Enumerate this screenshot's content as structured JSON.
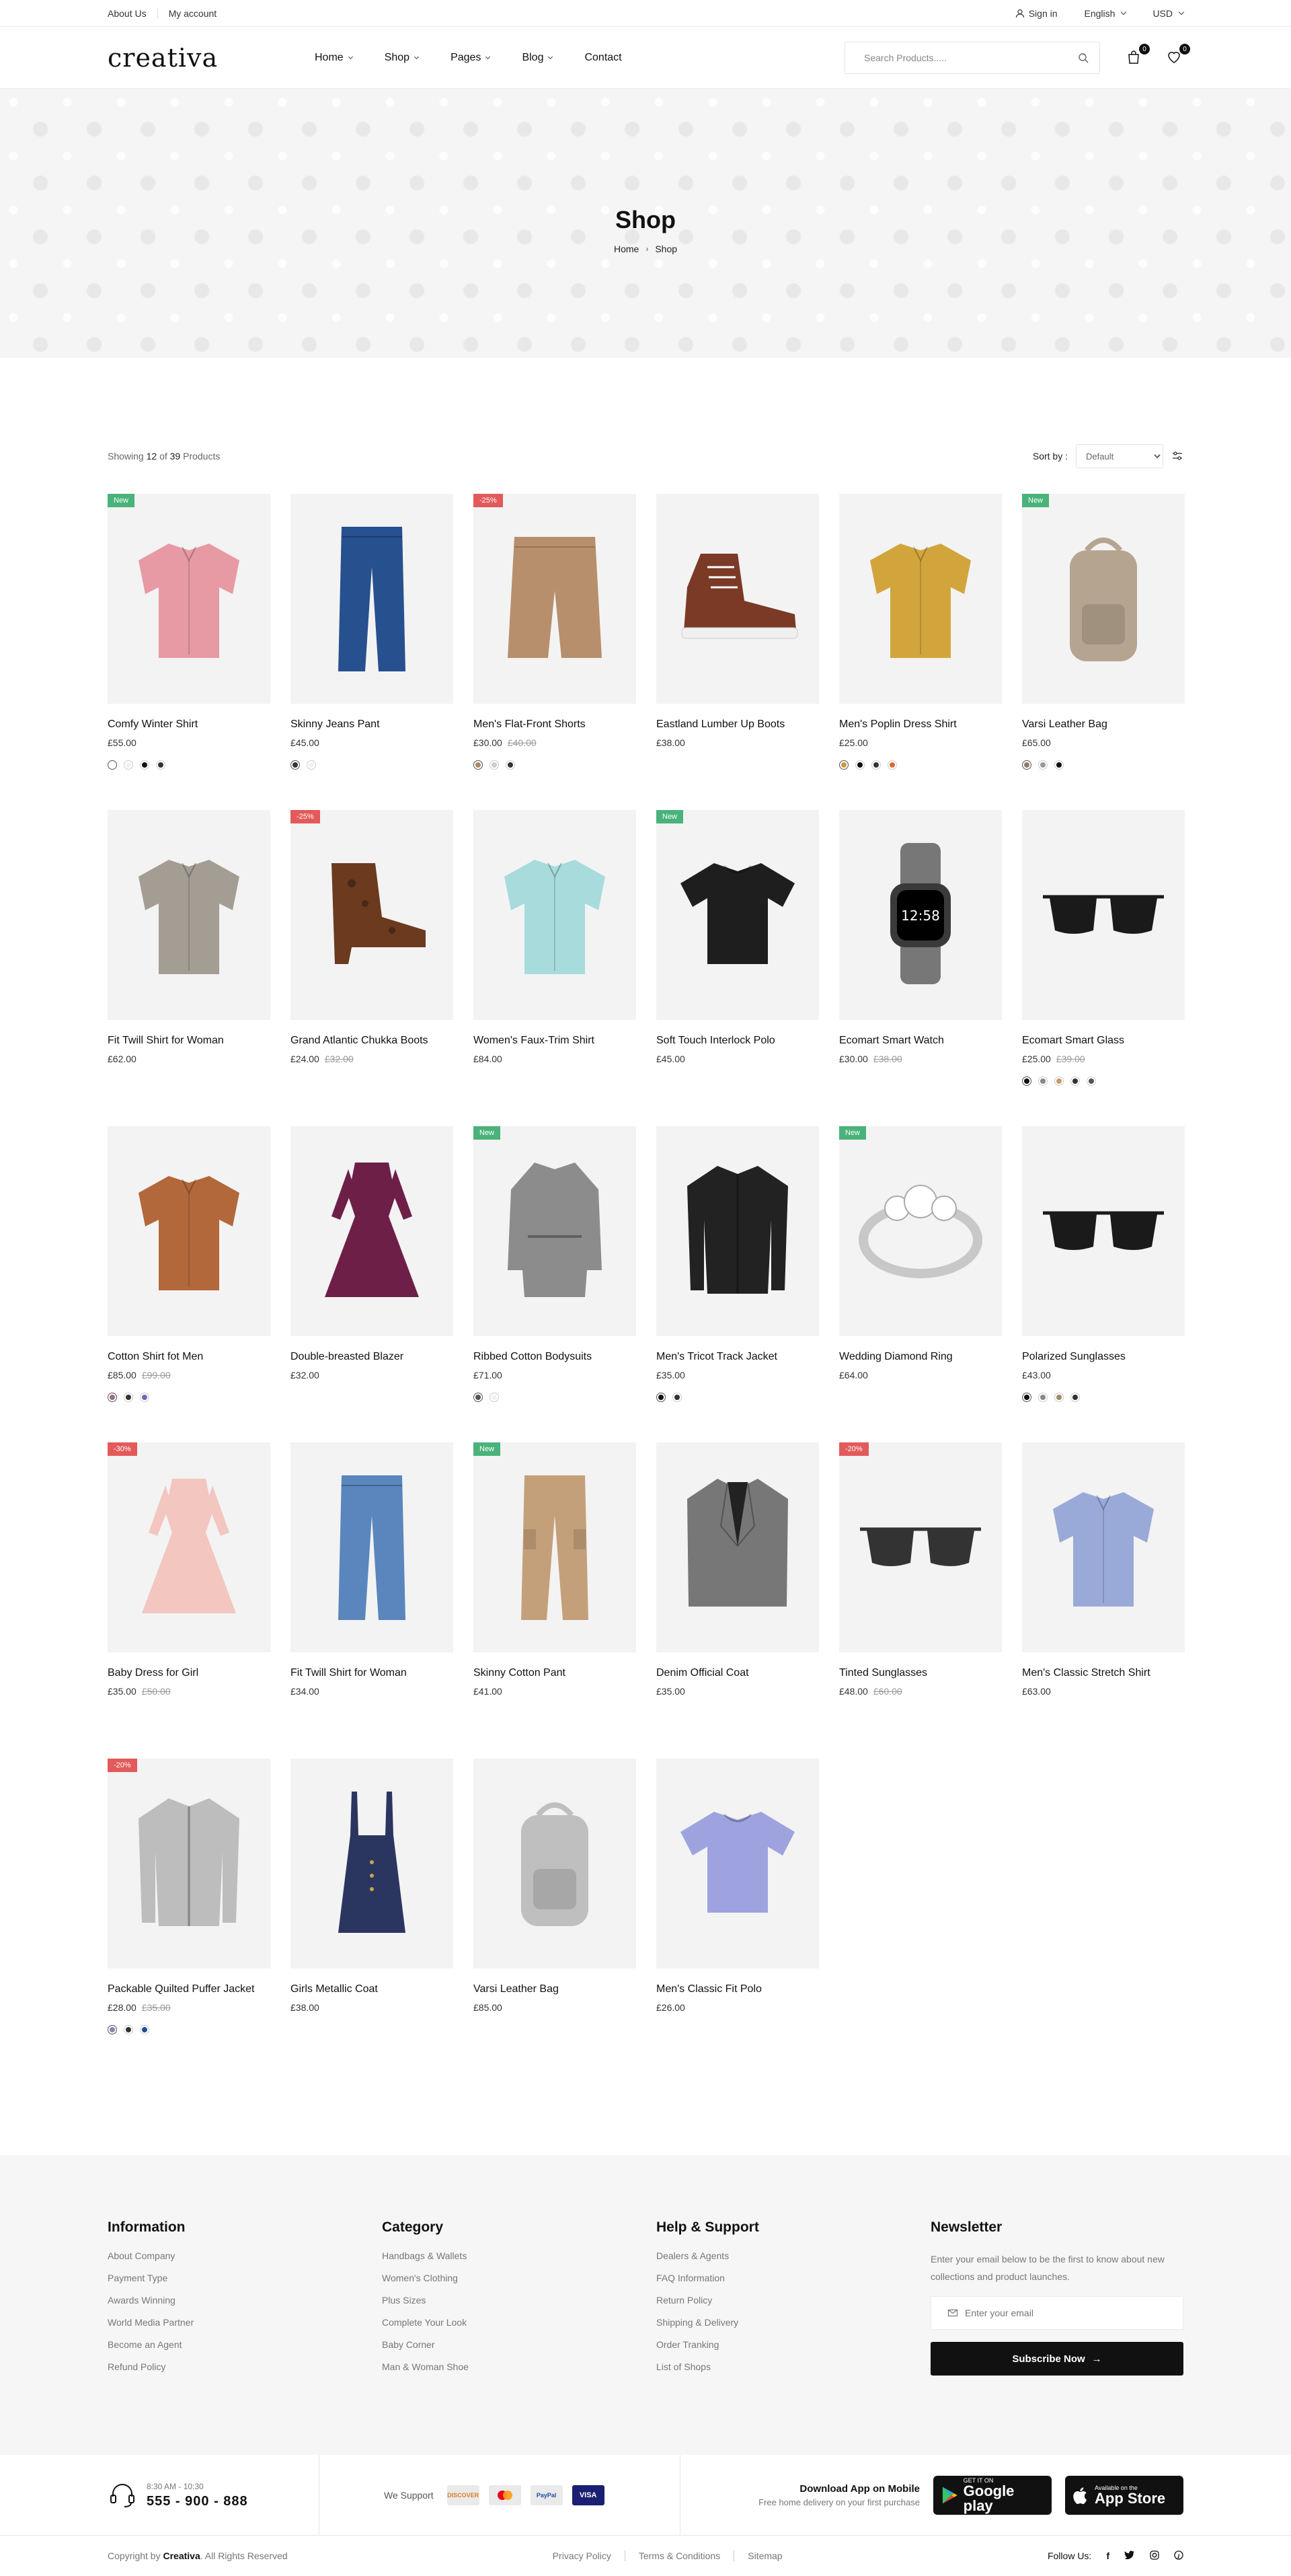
{
  "topbar": {
    "links": [
      "About Us",
      "My account"
    ],
    "sign_in": "Sign in",
    "language": "English",
    "currency": "USD"
  },
  "header": {
    "logo": "creativa",
    "nav": [
      "Home",
      "Shop",
      "Pages",
      "Blog",
      "Contact"
    ],
    "search_placeholder": "Search Products.....",
    "cart_count": "0",
    "wishlist_count": "0"
  },
  "hero": {
    "title": "Shop",
    "breadcrumb": [
      "Home",
      "Shop"
    ]
  },
  "toolbar": {
    "showing_prefix": "Showing",
    "showing_count": "12",
    "showing_of": "of",
    "showing_total": "39",
    "showing_suffix": "Products",
    "sort_label": "Sort by :",
    "sort_value": "Default"
  },
  "products": [
    {
      "name": "Comfy Winter Shirt",
      "price": "£55.00",
      "old": "",
      "tag": "New",
      "tag_type": "new",
      "icon": "shirt-icon",
      "color": "#e79aa3",
      "swatches": [
        "#ffffff",
        "#f2f2f2",
        "#111111",
        "#333333"
      ]
    },
    {
      "name": "Skinny Jeans Pant",
      "price": "£45.00",
      "old": "",
      "tag": "",
      "tag_type": "",
      "icon": "jeans-icon",
      "color": "#27508f",
      "swatches": [
        "#333333",
        "#f2f2f2"
      ]
    },
    {
      "name": "Men's Flat-Front Shorts",
      "price": "£30.00",
      "old": "£40.00",
      "tag": "-25%",
      "tag_type": "sale",
      "icon": "shorts-icon",
      "color": "#b88f6c",
      "swatches": [
        "#a98b6b",
        "#cccccc",
        "#333333"
      ]
    },
    {
      "name": "Eastland Lumber Up Boots",
      "price": "£38.00",
      "old": "",
      "tag": "",
      "tag_type": "",
      "icon": "sneaker-icon",
      "color": "#7a3a26",
      "swatches": []
    },
    {
      "name": "Men's Poplin Dress Shirt",
      "price": "£25.00",
      "old": "",
      "tag": "",
      "tag_type": "",
      "icon": "shirt-icon",
      "color": "#d2a53c",
      "swatches": [
        "#c99b3b",
        "#111111",
        "#333333",
        "#d96a30"
      ]
    },
    {
      "name": "Varsi Leather Bag",
      "price": "£65.00",
      "old": "",
      "tag": "New",
      "tag_type": "new",
      "icon": "backpack-icon",
      "color": "#b5a590",
      "swatches": [
        "#8b7d6b",
        "#999999",
        "#111111"
      ]
    },
    {
      "name": "Fit Twill Shirt for Woman",
      "price": "£62.00",
      "old": "",
      "tag": "",
      "tag_type": "",
      "icon": "shirt-icon",
      "color": "#a39d93",
      "swatches": []
    },
    {
      "name": "Grand Atlantic Chukka Boots",
      "price": "£24.00",
      "old": "£32.00",
      "tag": "-25%",
      "tag_type": "sale",
      "icon": "boot-icon",
      "color": "#6b3a1f",
      "swatches": []
    },
    {
      "name": "Women's Faux-Trim Shirt",
      "price": "£84.00",
      "old": "",
      "tag": "",
      "tag_type": "",
      "icon": "shirt-icon",
      "color": "#a8dbdc",
      "swatches": []
    },
    {
      "name": "Soft Touch Interlock Polo",
      "price": "£45.00",
      "old": "",
      "tag": "New",
      "tag_type": "new",
      "icon": "tshirt-icon",
      "color": "#1e1e1e",
      "swatches": []
    },
    {
      "name": "Ecomart Smart Watch",
      "price": "£30.00",
      "old": "£38.00",
      "tag": "",
      "tag_type": "",
      "icon": "watch-icon",
      "color": "#777777",
      "swatches": []
    },
    {
      "name": "Ecomart Smart Glass",
      "price": "£25.00",
      "old": "£39.00",
      "tag": "",
      "tag_type": "",
      "icon": "sunglasses-icon",
      "color": "#1a1a1a",
      "swatches": [
        "#111111",
        "#888888",
        "#c89a6a",
        "#333333",
        "#555555"
      ]
    },
    {
      "name": "Cotton Shirt fot Men",
      "price": "£85.00",
      "old": "£99.00",
      "tag": "",
      "tag_type": "",
      "icon": "shirt-icon",
      "color": "#b2683a",
      "swatches": [
        "#9a6b8a",
        "#333333",
        "#6a6ab0"
      ]
    },
    {
      "name": "Double-breasted Blazer",
      "price": "£32.00",
      "old": "",
      "tag": "",
      "tag_type": "",
      "icon": "dress-icon",
      "color": "#6e1f48",
      "swatches": []
    },
    {
      "name": "Ribbed Cotton Bodysuits",
      "price": "£71.00",
      "old": "",
      "tag": "New",
      "tag_type": "new",
      "icon": "robe-icon",
      "color": "#8c8c8c",
      "swatches": [
        "#555555",
        "#f2f2f2"
      ]
    },
    {
      "name": "Men's Tricot Track Jacket",
      "price": "£35.00",
      "old": "",
      "tag": "",
      "tag_type": "",
      "icon": "jacket-icon",
      "color": "#222222",
      "swatches": [
        "#111111",
        "#333333"
      ]
    },
    {
      "name": "Wedding Diamond Ring",
      "price": "£64.00",
      "old": "",
      "tag": "New",
      "tag_type": "new",
      "icon": "ring-icon",
      "color": "#c8c8c8",
      "swatches": []
    },
    {
      "name": "Polarized Sunglasses",
      "price": "£43.00",
      "old": "",
      "tag": "",
      "tag_type": "",
      "icon": "sunglasses-icon",
      "color": "#1a1a1a",
      "swatches": [
        "#111111",
        "#888888",
        "#9b8b6b",
        "#333333"
      ]
    },
    {
      "name": "Baby Dress for Girl",
      "price": "£35.00",
      "old": "£50.00",
      "tag": "-30%",
      "tag_type": "sale",
      "icon": "dress-icon",
      "color": "#f3c6c0",
      "swatches": []
    },
    {
      "name": "Fit Twill Shirt for Woman",
      "price": "£34.00",
      "old": "",
      "tag": "",
      "tag_type": "",
      "icon": "jeans-icon",
      "color": "#5a86bd",
      "swatches": []
    },
    {
      "name": "Skinny Cotton Pant",
      "price": "£41.00",
      "old": "",
      "tag": "New",
      "tag_type": "new",
      "icon": "pants-icon",
      "color": "#c4a07a",
      "swatches": []
    },
    {
      "name": "Denim Official Coat",
      "price": "£35.00",
      "old": "",
      "tag": "",
      "tag_type": "",
      "icon": "coat-icon",
      "color": "#777777",
      "swatches": []
    },
    {
      "name": "Tinted Sunglasses",
      "price": "£48.00",
      "old": "£60.00",
      "tag": "-20%",
      "tag_type": "sale",
      "icon": "sunglasses-icon",
      "color": "#333333",
      "swatches": []
    },
    {
      "name": "Men's Classic Stretch Shirt",
      "price": "£63.00",
      "old": "",
      "tag": "",
      "tag_type": "",
      "icon": "shirt-icon",
      "color": "#9aaad8",
      "swatches": []
    },
    {
      "name": "Packable Quilted Puffer Jacket",
      "price": "£28.00",
      "old": "£35.00",
      "tag": "-20%",
      "tag_type": "sale",
      "icon": "jacket-icon",
      "color": "#bdbdbd",
      "swatches": [
        "#8888aa",
        "#333333",
        "#1f4f8f"
      ]
    },
    {
      "name": "Girls Metallic Coat",
      "price": "£38.00",
      "old": "",
      "tag": "",
      "tag_type": "",
      "icon": "overall-icon",
      "color": "#2b3660",
      "swatches": []
    },
    {
      "name": "Varsi Leather Bag",
      "price": "£85.00",
      "old": "",
      "tag": "",
      "tag_type": "",
      "icon": "backpack-icon",
      "color": "#bfbfbf",
      "swatches": []
    },
    {
      "name": "Men's Classic Fit Polo",
      "price": "£26.00",
      "old": "",
      "tag": "",
      "tag_type": "",
      "icon": "tshirt-icon",
      "color": "#9ea3e0",
      "swatches": []
    }
  ],
  "footer": {
    "columns": [
      {
        "title": "Information",
        "links": [
          "About Company",
          "Payment Type",
          "Awards Winning",
          "World Media Partner",
          "Become an Agent",
          "Refund Policy"
        ]
      },
      {
        "title": "Category",
        "links": [
          "Handbags & Wallets",
          "Women's Clothing",
          "Plus Sizes",
          "Complete Your Look",
          "Baby Corner",
          "Man & Woman Shoe"
        ]
      },
      {
        "title": "Help & Support",
        "links": [
          "Dealers & Agents",
          "FAQ Information",
          "Return Policy",
          "Shipping & Delivery",
          "Order Tranking",
          "List of Shops"
        ]
      }
    ],
    "newsletter": {
      "title": "Newsletter",
      "text": "Enter your email below to be the first to know about new collections and product launches.",
      "placeholder": "Enter your email",
      "button": "Subscribe Now"
    },
    "hours": "8:30 AM - 10:30",
    "phone": "555 - 900 - 888",
    "support_label": "We Support",
    "payments": [
      "DISCOVER",
      "MC",
      "PayPal",
      "VISA"
    ],
    "app_title": "Download App on Mobile",
    "app_sub": "Free home delivery on your first purchase",
    "google_small": "GET IT ON",
    "google_big": "Google play",
    "apple_small": "Available on the",
    "apple_big": "App Store",
    "copy_prefix": "Copyright by",
    "copy_brand": "Creativa",
    "copy_suffix": ". All Rights Reserved",
    "legal": [
      "Privacy Policy",
      "Terms & Conditions",
      "Sitemap"
    ],
    "follow": "Follow Us:"
  }
}
